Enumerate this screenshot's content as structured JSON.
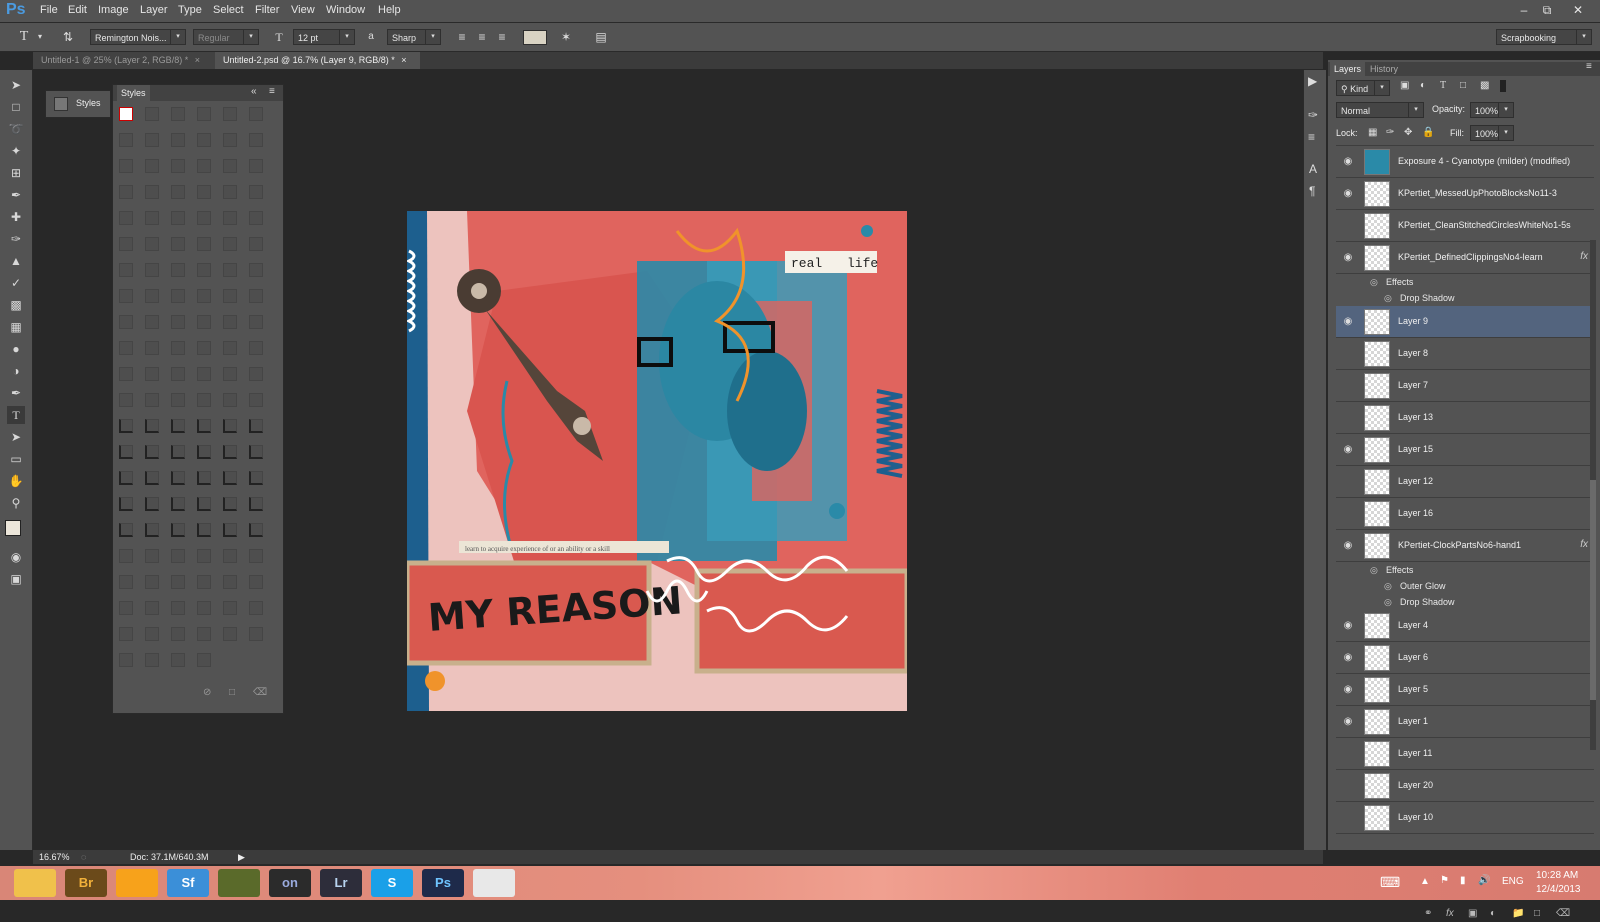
{
  "app": {
    "logo": "Ps"
  },
  "menu": [
    "File",
    "Edit",
    "Image",
    "Layer",
    "Type",
    "Select",
    "Filter",
    "View",
    "Window",
    "Help"
  ],
  "options": {
    "font_family": "Remington Nois...",
    "font_style": "Regular",
    "font_size": "12 pt",
    "aa_label": "a",
    "anti_alias": "Sharp",
    "workspace": "Scrapbooking"
  },
  "tabs": [
    {
      "label": "Untitled-1 @ 25% (Layer 2, RGB/8) *",
      "close": "×"
    },
    {
      "label": "Untitled-2.psd @ 16.7% (Layer 9, RGB/8) *",
      "close": "×"
    }
  ],
  "styles_dock": {
    "label": "Styles"
  },
  "styles_panel": {
    "title": "Styles"
  },
  "canvas": {
    "tag_real": "real",
    "tag_life": "life",
    "caption": "learn to acquire experience of or an ability or a skill",
    "title_text": "MY REASON"
  },
  "layers_panel": {
    "tab_layers": "Layers",
    "tab_history": "History",
    "filter_kind": "Kind",
    "blend_mode": "Normal",
    "opacity_label": "Opacity:",
    "opacity_value": "100%",
    "lock_label": "Lock:",
    "fill_label": "Fill:",
    "fill_value": "100%",
    "fx_symbol": "fx",
    "effects_label": "Effects",
    "layers": [
      {
        "name": "Exposure 4 - Cyanotype (milder) (modified)",
        "visible": true
      },
      {
        "name": "KPertiet_MessedUpPhotoBlocksNo11-3",
        "visible": true
      },
      {
        "name": "KPertiet_CleanStitchedCirclesWhiteNo1-5s",
        "visible": false
      },
      {
        "name": "KPertiet_DefinedClippingsNo4-learn",
        "visible": true,
        "effects": [
          "Drop Shadow"
        ]
      },
      {
        "name": "Layer 9",
        "visible": true,
        "selected": true
      },
      {
        "name": "Layer 8",
        "visible": false
      },
      {
        "name": "Layer 7",
        "visible": false
      },
      {
        "name": "Layer 13",
        "visible": false
      },
      {
        "name": "Layer 15",
        "visible": true
      },
      {
        "name": "Layer 12",
        "visible": false
      },
      {
        "name": "Layer 16",
        "visible": false
      },
      {
        "name": "KPertiet-ClockPartsNo6-hand1",
        "visible": true,
        "effects": [
          "Outer Glow",
          "Drop Shadow"
        ]
      },
      {
        "name": "Layer 4",
        "visible": true
      },
      {
        "name": "Layer 6",
        "visible": true
      },
      {
        "name": "Layer 5",
        "visible": true
      },
      {
        "name": "Layer 1",
        "visible": true
      },
      {
        "name": "Layer 11",
        "visible": false
      },
      {
        "name": "Layer 20",
        "visible": false
      },
      {
        "name": "Layer 10",
        "visible": false
      }
    ]
  },
  "status": {
    "zoom": "16.67%",
    "doc": "Doc: 37.1M/640.3M"
  },
  "taskbar": {
    "apps": [
      {
        "name": "file-explorer",
        "label": ""
      },
      {
        "name": "bridge",
        "label": "Br"
      },
      {
        "name": "media-player",
        "label": ""
      },
      {
        "name": "app-sf",
        "label": "Sf"
      },
      {
        "name": "app-pen",
        "label": ""
      },
      {
        "name": "app-on",
        "label": "on"
      },
      {
        "name": "lightroom",
        "label": "Lr"
      },
      {
        "name": "skype",
        "label": "S"
      },
      {
        "name": "photoshop",
        "label": "Ps"
      },
      {
        "name": "chrome",
        "label": ""
      }
    ],
    "lang": "ENG",
    "time": "10:28 AM",
    "date": "12/4/2013"
  }
}
